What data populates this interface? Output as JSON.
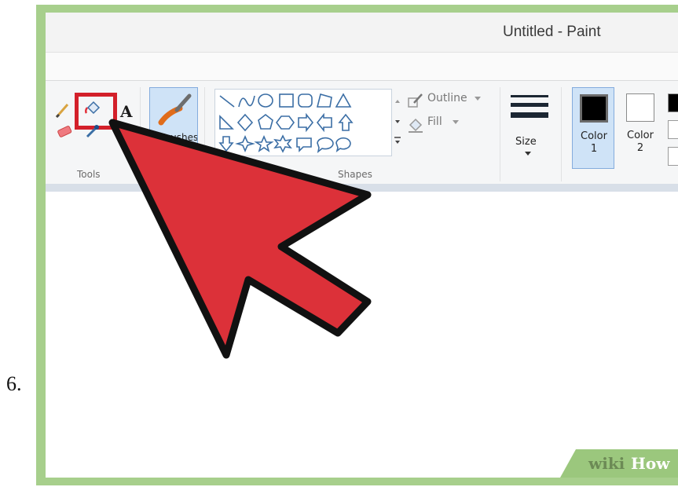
{
  "step_number": "6.",
  "window": {
    "title": "Untitled - Paint"
  },
  "ribbon": {
    "tools": {
      "group_label": "Tools"
    },
    "brushes": {
      "label": "Brushes"
    },
    "shapes": {
      "group_label": "Shapes",
      "outline_label": "Outline",
      "fill_label": "Fill"
    },
    "size": {
      "label": "Size"
    },
    "colors": [
      {
        "label_line1": "Color",
        "label_line2": "1",
        "swatch": "#000000",
        "active": true
      },
      {
        "label_line1": "Color",
        "label_line2": "2",
        "swatch": "#ffffff",
        "active": false
      }
    ]
  },
  "colors": {
    "frame": "#a7cf8c",
    "highlight": "#d3202a",
    "arrow": "#dc3139",
    "selected_bg": "#cfe3f7"
  },
  "watermark": {
    "part1": "wiki",
    "part2": "How"
  },
  "icons": [
    "pencil-icon",
    "fill-bucket-icon",
    "text-icon",
    "eraser-icon",
    "color-picker-icon",
    "brush-icon"
  ]
}
